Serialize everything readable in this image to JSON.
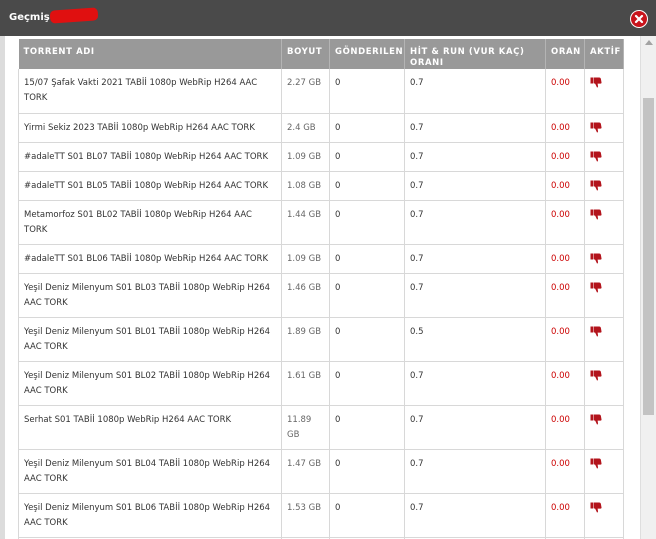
{
  "window": {
    "title": "Geçmiş:"
  },
  "table": {
    "headers": [
      "TORRENT ADI",
      "BOYUT",
      "GÖNDERILEN",
      "HİT & RUN (VUR KAÇ) ORANI",
      "ORAN",
      "AKTİF"
    ],
    "rows": [
      {
        "name": "15/07 Şafak Vakti 2021 TABİİ 1080p WebRip H264 AAC TORK",
        "size": "2.27 GB",
        "sent": "0",
        "hnr": "0.7",
        "ratio": "0.00",
        "active_icon": "thumbs-down-icon"
      },
      {
        "name": "Yirmi Sekiz 2023 TABİİ 1080p WebRip H264 AAC TORK",
        "size": "2.4 GB",
        "sent": "0",
        "hnr": "0.7",
        "ratio": "0.00",
        "active_icon": "thumbs-down-icon"
      },
      {
        "name": "#adaleTT S01 BL07 TABİİ 1080p WebRip H264 AAC TORK",
        "size": "1.09 GB",
        "sent": "0",
        "hnr": "0.7",
        "ratio": "0.00",
        "active_icon": "thumbs-down-icon"
      },
      {
        "name": "#adaleTT S01 BL05 TABİİ 1080p WebRip H264 AAC TORK",
        "size": "1.08 GB",
        "sent": "0",
        "hnr": "0.7",
        "ratio": "0.00",
        "active_icon": "thumbs-down-icon"
      },
      {
        "name": "Metamorfoz S01 BL02 TABİİ 1080p WebRip H264 AAC TORK",
        "size": "1.44 GB",
        "sent": "0",
        "hnr": "0.7",
        "ratio": "0.00",
        "active_icon": "thumbs-down-icon"
      },
      {
        "name": "#adaleTT S01 BL06 TABİİ 1080p WebRip H264 AAC TORK",
        "size": "1.09 GB",
        "sent": "0",
        "hnr": "0.7",
        "ratio": "0.00",
        "active_icon": "thumbs-down-icon"
      },
      {
        "name": "Yeşil Deniz Milenyum S01 BL03 TABİİ 1080p WebRip H264 AAC TORK",
        "size": "1.46 GB",
        "sent": "0",
        "hnr": "0.7",
        "ratio": "0.00",
        "active_icon": "thumbs-down-icon"
      },
      {
        "name": "Yeşil Deniz Milenyum S01 BL01 TABİİ 1080p WebRip H264 AAC TORK",
        "size": "1.89 GB",
        "sent": "0",
        "hnr": "0.5",
        "ratio": "0.00",
        "active_icon": "thumbs-down-icon"
      },
      {
        "name": "Yeşil Deniz Milenyum S01 BL02 TABİİ 1080p WebRip H264 AAC TORK",
        "size": "1.61 GB",
        "sent": "0",
        "hnr": "0.7",
        "ratio": "0.00",
        "active_icon": "thumbs-down-icon"
      },
      {
        "name": "Serhat S01 TABİİ 1080p WebRip H264 AAC TORK",
        "size": "11.89 GB",
        "sent": "0",
        "hnr": "0.7",
        "ratio": "0.00",
        "active_icon": "thumbs-down-icon"
      },
      {
        "name": "Yeşil Deniz Milenyum S01 BL04 TABİİ 1080p WebRip H264 AAC TORK",
        "size": "1.47 GB",
        "sent": "0",
        "hnr": "0.7",
        "ratio": "0.00",
        "active_icon": "thumbs-down-icon"
      },
      {
        "name": "Yeşil Deniz Milenyum S01 BL06 TABİİ 1080p WebRip H264 AAC TORK",
        "size": "1.53 GB",
        "sent": "0",
        "hnr": "0.7",
        "ratio": "0.00",
        "active_icon": "thumbs-down-icon"
      }
    ]
  },
  "colors": {
    "titlebar": "#4a4a4a",
    "header": "#999999",
    "ratio_text": "#cc0000",
    "thumb_icon": "#b3141c",
    "close_button": "#c8141c"
  }
}
